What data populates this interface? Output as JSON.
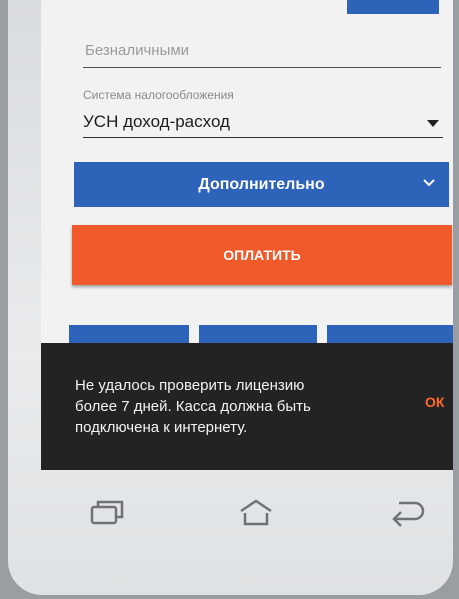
{
  "payment": {
    "method_value": "Безналичными"
  },
  "tax": {
    "caption": "Система налогообложения",
    "value": "УСН доход-расход"
  },
  "buttons": {
    "extra_label": "Дополнительно",
    "pay_label": "ОПЛАТИТЬ"
  },
  "snackbar": {
    "lines": [
      "Не удалось проверить лицензию",
      "более 7 дней. Касса должна быть",
      "подключена к интернету."
    ],
    "action": "ОК"
  },
  "colors": {
    "primary": "#2d63b8",
    "accent": "#f0592a",
    "snackbar_bg": "#232323",
    "snackbar_action": "#ff6a2a"
  },
  "icons": {
    "recent": "recent-apps-icon",
    "home": "home-icon",
    "back": "back-icon",
    "dropdown": "chevron-down-icon"
  }
}
